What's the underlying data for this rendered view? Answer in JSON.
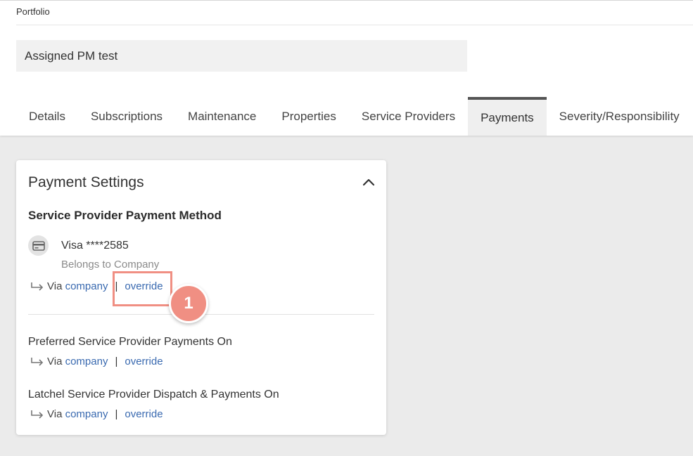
{
  "breadcrumb": "Portfolio",
  "portfolio_name": "Assigned PM test",
  "tabs": [
    {
      "label": "Details"
    },
    {
      "label": "Subscriptions"
    },
    {
      "label": "Maintenance"
    },
    {
      "label": "Properties"
    },
    {
      "label": "Service Providers"
    },
    {
      "label": "Payments",
      "active": true
    },
    {
      "label": "Severity/Responsibility"
    }
  ],
  "card": {
    "title": "Payment Settings",
    "section_title": "Service Provider Payment Method",
    "method": {
      "icon": "credit-card-icon",
      "name": "Visa ****2585",
      "owner": "Belongs to Company"
    },
    "via_rows": [
      {
        "prefix": "Via",
        "link": "company",
        "action": "override"
      },
      {
        "prefix": "Via",
        "link": "company",
        "action": "override"
      },
      {
        "prefix": "Via",
        "link": "company",
        "action": "override"
      }
    ],
    "settings": [
      {
        "label": "Preferred Service Provider Payments On"
      },
      {
        "label": "Latchel Service Provider Dispatch & Payments On"
      }
    ]
  },
  "annotation": {
    "step": "1",
    "color": "#f08f83"
  }
}
